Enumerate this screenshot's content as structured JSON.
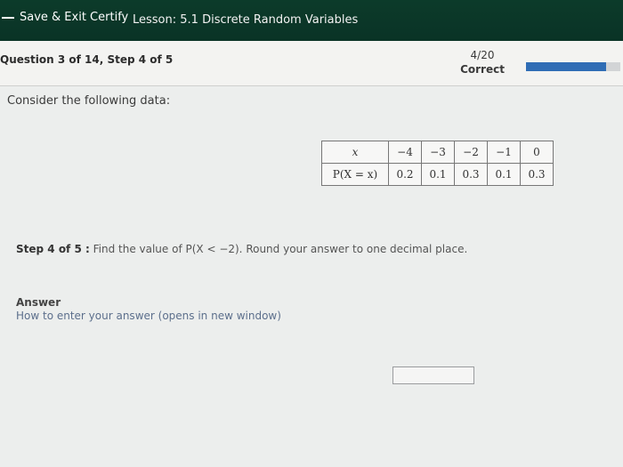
{
  "header": {
    "exit_label": "Save & Exit Certify",
    "lesson_title": "Lesson: 5.1 Discrete Random Variables"
  },
  "question": {
    "title": "Question 3 of 14, Step 4 of 5",
    "score": "4/20",
    "status": "Correct",
    "progress_fraction": 0.85
  },
  "prompt": "Consider the following data:",
  "table": {
    "row_headers": [
      "x",
      "P(X = x)"
    ],
    "x_values": [
      "−4",
      "−3",
      "−2",
      "−1",
      "0"
    ],
    "p_values": [
      "0.2",
      "0.1",
      "0.3",
      "0.1",
      "0.3"
    ]
  },
  "step": {
    "label": "Step 4 of 5 :",
    "text": "Find the value of P(X < −2). Round your answer to one decimal place."
  },
  "answer": {
    "label": "Answer",
    "help_link": "How to enter your answer (opens in new window)",
    "value": ""
  },
  "colors": {
    "header_bg": "#0c3b2a",
    "progress_fill": "#2f6db5"
  }
}
